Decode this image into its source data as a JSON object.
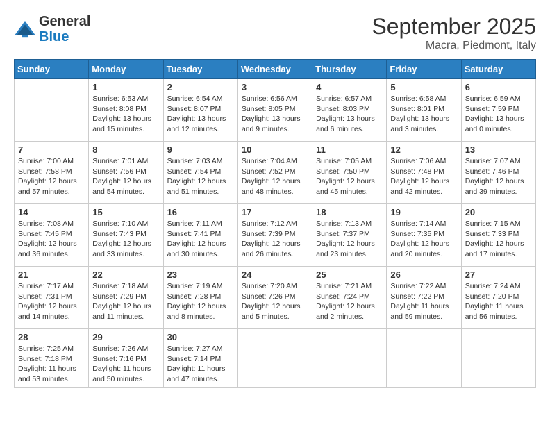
{
  "logo": {
    "general": "General",
    "blue": "Blue"
  },
  "title": "September 2025",
  "location": "Macra, Piedmont, Italy",
  "days_of_week": [
    "Sunday",
    "Monday",
    "Tuesday",
    "Wednesday",
    "Thursday",
    "Friday",
    "Saturday"
  ],
  "weeks": [
    [
      {
        "day": "",
        "info": ""
      },
      {
        "day": "1",
        "info": "Sunrise: 6:53 AM\nSunset: 8:08 PM\nDaylight: 13 hours\nand 15 minutes."
      },
      {
        "day": "2",
        "info": "Sunrise: 6:54 AM\nSunset: 8:07 PM\nDaylight: 13 hours\nand 12 minutes."
      },
      {
        "day": "3",
        "info": "Sunrise: 6:56 AM\nSunset: 8:05 PM\nDaylight: 13 hours\nand 9 minutes."
      },
      {
        "day": "4",
        "info": "Sunrise: 6:57 AM\nSunset: 8:03 PM\nDaylight: 13 hours\nand 6 minutes."
      },
      {
        "day": "5",
        "info": "Sunrise: 6:58 AM\nSunset: 8:01 PM\nDaylight: 13 hours\nand 3 minutes."
      },
      {
        "day": "6",
        "info": "Sunrise: 6:59 AM\nSunset: 7:59 PM\nDaylight: 13 hours\nand 0 minutes."
      }
    ],
    [
      {
        "day": "7",
        "info": "Sunrise: 7:00 AM\nSunset: 7:58 PM\nDaylight: 12 hours\nand 57 minutes."
      },
      {
        "day": "8",
        "info": "Sunrise: 7:01 AM\nSunset: 7:56 PM\nDaylight: 12 hours\nand 54 minutes."
      },
      {
        "day": "9",
        "info": "Sunrise: 7:03 AM\nSunset: 7:54 PM\nDaylight: 12 hours\nand 51 minutes."
      },
      {
        "day": "10",
        "info": "Sunrise: 7:04 AM\nSunset: 7:52 PM\nDaylight: 12 hours\nand 48 minutes."
      },
      {
        "day": "11",
        "info": "Sunrise: 7:05 AM\nSunset: 7:50 PM\nDaylight: 12 hours\nand 45 minutes."
      },
      {
        "day": "12",
        "info": "Sunrise: 7:06 AM\nSunset: 7:48 PM\nDaylight: 12 hours\nand 42 minutes."
      },
      {
        "day": "13",
        "info": "Sunrise: 7:07 AM\nSunset: 7:46 PM\nDaylight: 12 hours\nand 39 minutes."
      }
    ],
    [
      {
        "day": "14",
        "info": "Sunrise: 7:08 AM\nSunset: 7:45 PM\nDaylight: 12 hours\nand 36 minutes."
      },
      {
        "day": "15",
        "info": "Sunrise: 7:10 AM\nSunset: 7:43 PM\nDaylight: 12 hours\nand 33 minutes."
      },
      {
        "day": "16",
        "info": "Sunrise: 7:11 AM\nSunset: 7:41 PM\nDaylight: 12 hours\nand 30 minutes."
      },
      {
        "day": "17",
        "info": "Sunrise: 7:12 AM\nSunset: 7:39 PM\nDaylight: 12 hours\nand 26 minutes."
      },
      {
        "day": "18",
        "info": "Sunrise: 7:13 AM\nSunset: 7:37 PM\nDaylight: 12 hours\nand 23 minutes."
      },
      {
        "day": "19",
        "info": "Sunrise: 7:14 AM\nSunset: 7:35 PM\nDaylight: 12 hours\nand 20 minutes."
      },
      {
        "day": "20",
        "info": "Sunrise: 7:15 AM\nSunset: 7:33 PM\nDaylight: 12 hours\nand 17 minutes."
      }
    ],
    [
      {
        "day": "21",
        "info": "Sunrise: 7:17 AM\nSunset: 7:31 PM\nDaylight: 12 hours\nand 14 minutes."
      },
      {
        "day": "22",
        "info": "Sunrise: 7:18 AM\nSunset: 7:29 PM\nDaylight: 12 hours\nand 11 minutes."
      },
      {
        "day": "23",
        "info": "Sunrise: 7:19 AM\nSunset: 7:28 PM\nDaylight: 12 hours\nand 8 minutes."
      },
      {
        "day": "24",
        "info": "Sunrise: 7:20 AM\nSunset: 7:26 PM\nDaylight: 12 hours\nand 5 minutes."
      },
      {
        "day": "25",
        "info": "Sunrise: 7:21 AM\nSunset: 7:24 PM\nDaylight: 12 hours\nand 2 minutes."
      },
      {
        "day": "26",
        "info": "Sunrise: 7:22 AM\nSunset: 7:22 PM\nDaylight: 11 hours\nand 59 minutes."
      },
      {
        "day": "27",
        "info": "Sunrise: 7:24 AM\nSunset: 7:20 PM\nDaylight: 11 hours\nand 56 minutes."
      }
    ],
    [
      {
        "day": "28",
        "info": "Sunrise: 7:25 AM\nSunset: 7:18 PM\nDaylight: 11 hours\nand 53 minutes."
      },
      {
        "day": "29",
        "info": "Sunrise: 7:26 AM\nSunset: 7:16 PM\nDaylight: 11 hours\nand 50 minutes."
      },
      {
        "day": "30",
        "info": "Sunrise: 7:27 AM\nSunset: 7:14 PM\nDaylight: 11 hours\nand 47 minutes."
      },
      {
        "day": "",
        "info": ""
      },
      {
        "day": "",
        "info": ""
      },
      {
        "day": "",
        "info": ""
      },
      {
        "day": "",
        "info": ""
      }
    ]
  ]
}
